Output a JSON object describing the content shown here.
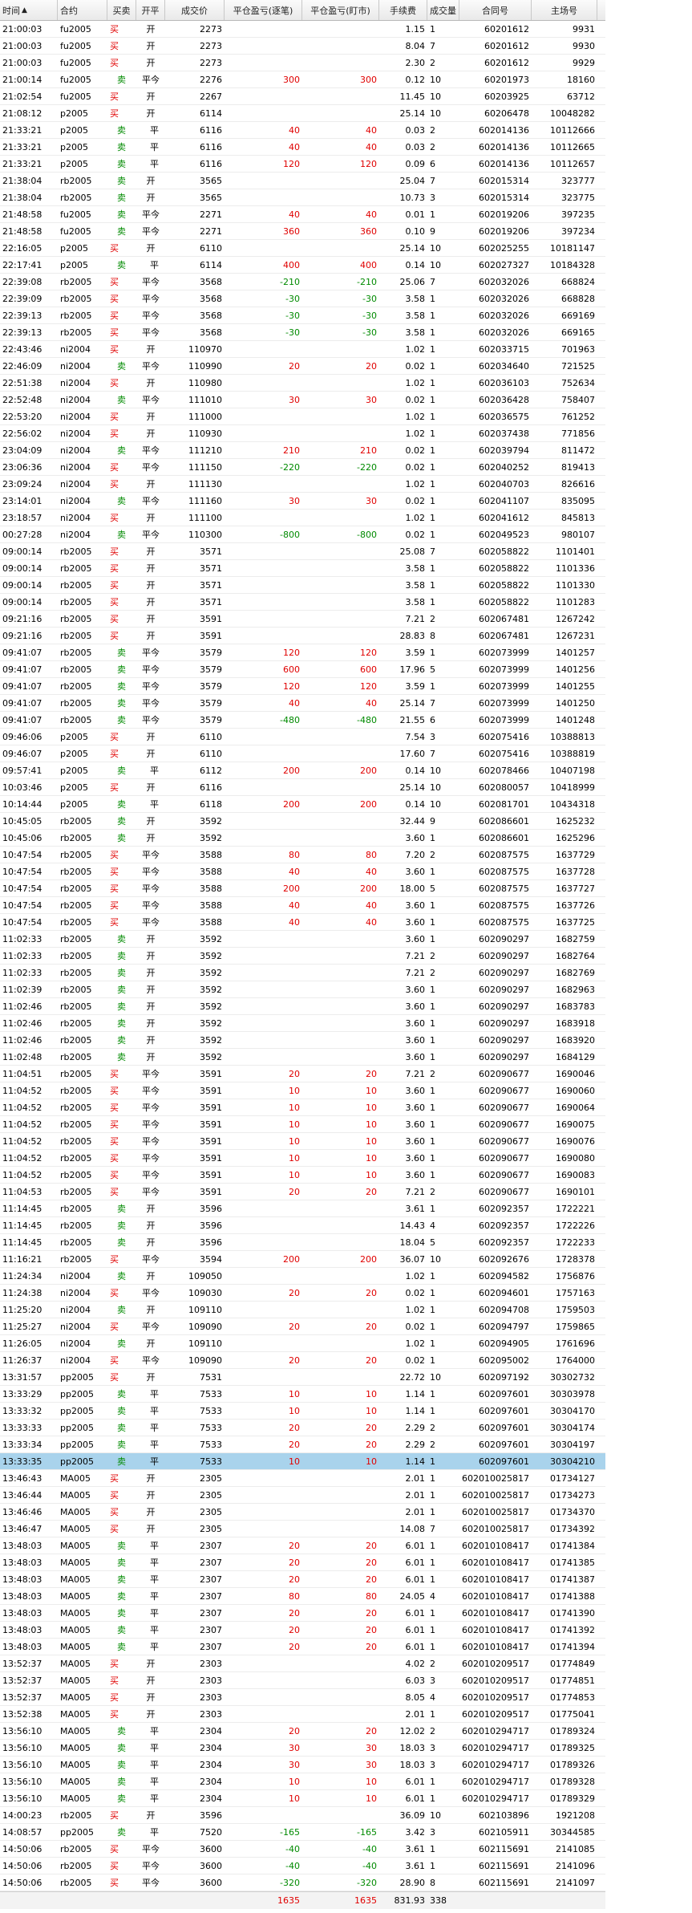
{
  "columns": {
    "time": "时间",
    "contract": "合约",
    "side": "买卖",
    "oc": "开平",
    "price": "成交价",
    "pnl_close": "平仓盈亏(逐笔)",
    "pnl_mark": "平仓盈亏(盯市)",
    "fee": "手续费",
    "qty": "成交量",
    "order": "合同号",
    "seq": "主场号",
    "sort_arrow": "▲"
  },
  "rows": [
    [
      "21:00:03",
      "fu2005",
      "买",
      "开",
      "2273",
      "",
      "",
      "1.15",
      "1",
      "60201612",
      "9931"
    ],
    [
      "21:00:03",
      "fu2005",
      "买",
      "开",
      "2273",
      "",
      "",
      "8.04",
      "7",
      "60201612",
      "9930"
    ],
    [
      "21:00:03",
      "fu2005",
      "买",
      "开",
      "2273",
      "",
      "",
      "2.30",
      "2",
      "60201612",
      "9929"
    ],
    [
      "21:00:14",
      "fu2005",
      "卖",
      "平今",
      "2276",
      "300",
      "300",
      "0.12",
      "10",
      "60201973",
      "18160"
    ],
    [
      "21:02:54",
      "fu2005",
      "买",
      "开",
      "2267",
      "",
      "",
      "11.45",
      "10",
      "60203925",
      "63712"
    ],
    [
      "21:08:12",
      "p2005",
      "买",
      "开",
      "6114",
      "",
      "",
      "25.14",
      "10",
      "60206478",
      "10048282"
    ],
    [
      "21:33:21",
      "p2005",
      "卖",
      "平",
      "6116",
      "40",
      "40",
      "0.03",
      "2",
      "602014136",
      "10112666"
    ],
    [
      "21:33:21",
      "p2005",
      "卖",
      "平",
      "6116",
      "40",
      "40",
      "0.03",
      "2",
      "602014136",
      "10112665"
    ],
    [
      "21:33:21",
      "p2005",
      "卖",
      "平",
      "6116",
      "120",
      "120",
      "0.09",
      "6",
      "602014136",
      "10112657"
    ],
    [
      "21:38:04",
      "rb2005",
      "卖",
      "开",
      "3565",
      "",
      "",
      "25.04",
      "7",
      "602015314",
      "323777"
    ],
    [
      "21:38:04",
      "rb2005",
      "卖",
      "开",
      "3565",
      "",
      "",
      "10.73",
      "3",
      "602015314",
      "323775"
    ],
    [
      "21:48:58",
      "fu2005",
      "卖",
      "平今",
      "2271",
      "40",
      "40",
      "0.01",
      "1",
      "602019206",
      "397235"
    ],
    [
      "21:48:58",
      "fu2005",
      "卖",
      "平今",
      "2271",
      "360",
      "360",
      "0.10",
      "9",
      "602019206",
      "397234"
    ],
    [
      "22:16:05",
      "p2005",
      "买",
      "开",
      "6110",
      "",
      "",
      "25.14",
      "10",
      "602025255",
      "10181147"
    ],
    [
      "22:17:41",
      "p2005",
      "卖",
      "平",
      "6114",
      "400",
      "400",
      "0.14",
      "10",
      "602027327",
      "10184328"
    ],
    [
      "22:39:08",
      "rb2005",
      "买",
      "平今",
      "3568",
      "-210",
      "-210",
      "25.06",
      "7",
      "602032026",
      "668824"
    ],
    [
      "22:39:09",
      "rb2005",
      "买",
      "平今",
      "3568",
      "-30",
      "-30",
      "3.58",
      "1",
      "602032026",
      "668828"
    ],
    [
      "22:39:13",
      "rb2005",
      "买",
      "平今",
      "3568",
      "-30",
      "-30",
      "3.58",
      "1",
      "602032026",
      "669169"
    ],
    [
      "22:39:13",
      "rb2005",
      "买",
      "平今",
      "3568",
      "-30",
      "-30",
      "3.58",
      "1",
      "602032026",
      "669165"
    ],
    [
      "22:43:46",
      "ni2004",
      "买",
      "开",
      "110970",
      "",
      "",
      "1.02",
      "1",
      "602033715",
      "701963"
    ],
    [
      "22:46:09",
      "ni2004",
      "卖",
      "平今",
      "110990",
      "20",
      "20",
      "0.02",
      "1",
      "602034640",
      "721525"
    ],
    [
      "22:51:38",
      "ni2004",
      "买",
      "开",
      "110980",
      "",
      "",
      "1.02",
      "1",
      "602036103",
      "752634"
    ],
    [
      "22:52:48",
      "ni2004",
      "卖",
      "平今",
      "111010",
      "30",
      "30",
      "0.02",
      "1",
      "602036428",
      "758407"
    ],
    [
      "22:53:20",
      "ni2004",
      "买",
      "开",
      "111000",
      "",
      "",
      "1.02",
      "1",
      "602036575",
      "761252"
    ],
    [
      "22:56:02",
      "ni2004",
      "买",
      "开",
      "110930",
      "",
      "",
      "1.02",
      "1",
      "602037438",
      "771856"
    ],
    [
      "23:04:09",
      "ni2004",
      "卖",
      "平今",
      "111210",
      "210",
      "210",
      "0.02",
      "1",
      "602039794",
      "811472"
    ],
    [
      "23:06:36",
      "ni2004",
      "买",
      "平今",
      "111150",
      "-220",
      "-220",
      "0.02",
      "1",
      "602040252",
      "819413"
    ],
    [
      "23:09:24",
      "ni2004",
      "买",
      "开",
      "111130",
      "",
      "",
      "1.02",
      "1",
      "602040703",
      "826616"
    ],
    [
      "23:14:01",
      "ni2004",
      "卖",
      "平今",
      "111160",
      "30",
      "30",
      "0.02",
      "1",
      "602041107",
      "835095"
    ],
    [
      "23:18:57",
      "ni2004",
      "买",
      "开",
      "111100",
      "",
      "",
      "1.02",
      "1",
      "602041612",
      "845813"
    ],
    [
      "00:27:28",
      "ni2004",
      "卖",
      "平今",
      "110300",
      "-800",
      "-800",
      "0.02",
      "1",
      "602049523",
      "980107"
    ],
    [
      "09:00:14",
      "rb2005",
      "买",
      "开",
      "3571",
      "",
      "",
      "25.08",
      "7",
      "602058822",
      "1101401"
    ],
    [
      "09:00:14",
      "rb2005",
      "买",
      "开",
      "3571",
      "",
      "",
      "3.58",
      "1",
      "602058822",
      "1101336"
    ],
    [
      "09:00:14",
      "rb2005",
      "买",
      "开",
      "3571",
      "",
      "",
      "3.58",
      "1",
      "602058822",
      "1101330"
    ],
    [
      "09:00:14",
      "rb2005",
      "买",
      "开",
      "3571",
      "",
      "",
      "3.58",
      "1",
      "602058822",
      "1101283"
    ],
    [
      "09:21:16",
      "rb2005",
      "买",
      "开",
      "3591",
      "",
      "",
      "7.21",
      "2",
      "602067481",
      "1267242"
    ],
    [
      "09:21:16",
      "rb2005",
      "买",
      "开",
      "3591",
      "",
      "",
      "28.83",
      "8",
      "602067481",
      "1267231"
    ],
    [
      "09:41:07",
      "rb2005",
      "卖",
      "平今",
      "3579",
      "120",
      "120",
      "3.59",
      "1",
      "602073999",
      "1401257"
    ],
    [
      "09:41:07",
      "rb2005",
      "卖",
      "平今",
      "3579",
      "600",
      "600",
      "17.96",
      "5",
      "602073999",
      "1401256"
    ],
    [
      "09:41:07",
      "rb2005",
      "卖",
      "平今",
      "3579",
      "120",
      "120",
      "3.59",
      "1",
      "602073999",
      "1401255"
    ],
    [
      "09:41:07",
      "rb2005",
      "卖",
      "平今",
      "3579",
      "40",
      "40",
      "25.14",
      "7",
      "602073999",
      "1401250"
    ],
    [
      "09:41:07",
      "rb2005",
      "卖",
      "平今",
      "3579",
      "-480",
      "-480",
      "21.55",
      "6",
      "602073999",
      "1401248"
    ],
    [
      "09:46:06",
      "p2005",
      "买",
      "开",
      "6110",
      "",
      "",
      "7.54",
      "3",
      "602075416",
      "10388813"
    ],
    [
      "09:46:07",
      "p2005",
      "买",
      "开",
      "6110",
      "",
      "",
      "17.60",
      "7",
      "602075416",
      "10388819"
    ],
    [
      "09:57:41",
      "p2005",
      "卖",
      "平",
      "6112",
      "200",
      "200",
      "0.14",
      "10",
      "602078466",
      "10407198"
    ],
    [
      "10:03:46",
      "p2005",
      "买",
      "开",
      "6116",
      "",
      "",
      "25.14",
      "10",
      "602080057",
      "10418999"
    ],
    [
      "10:14:44",
      "p2005",
      "卖",
      "平",
      "6118",
      "200",
      "200",
      "0.14",
      "10",
      "602081701",
      "10434318"
    ],
    [
      "10:45:05",
      "rb2005",
      "卖",
      "开",
      "3592",
      "",
      "",
      "32.44",
      "9",
      "602086601",
      "1625232"
    ],
    [
      "10:45:06",
      "rb2005",
      "卖",
      "开",
      "3592",
      "",
      "",
      "3.60",
      "1",
      "602086601",
      "1625296"
    ],
    [
      "10:47:54",
      "rb2005",
      "买",
      "平今",
      "3588",
      "80",
      "80",
      "7.20",
      "2",
      "602087575",
      "1637729"
    ],
    [
      "10:47:54",
      "rb2005",
      "买",
      "平今",
      "3588",
      "40",
      "40",
      "3.60",
      "1",
      "602087575",
      "1637728"
    ],
    [
      "10:47:54",
      "rb2005",
      "买",
      "平今",
      "3588",
      "200",
      "200",
      "18.00",
      "5",
      "602087575",
      "1637727"
    ],
    [
      "10:47:54",
      "rb2005",
      "买",
      "平今",
      "3588",
      "40",
      "40",
      "3.60",
      "1",
      "602087575",
      "1637726"
    ],
    [
      "10:47:54",
      "rb2005",
      "买",
      "平今",
      "3588",
      "40",
      "40",
      "3.60",
      "1",
      "602087575",
      "1637725"
    ],
    [
      "11:02:33",
      "rb2005",
      "卖",
      "开",
      "3592",
      "",
      "",
      "3.60",
      "1",
      "602090297",
      "1682759"
    ],
    [
      "11:02:33",
      "rb2005",
      "卖",
      "开",
      "3592",
      "",
      "",
      "7.21",
      "2",
      "602090297",
      "1682764"
    ],
    [
      "11:02:33",
      "rb2005",
      "卖",
      "开",
      "3592",
      "",
      "",
      "7.21",
      "2",
      "602090297",
      "1682769"
    ],
    [
      "11:02:39",
      "rb2005",
      "卖",
      "开",
      "3592",
      "",
      "",
      "3.60",
      "1",
      "602090297",
      "1682963"
    ],
    [
      "11:02:46",
      "rb2005",
      "卖",
      "开",
      "3592",
      "",
      "",
      "3.60",
      "1",
      "602090297",
      "1683783"
    ],
    [
      "11:02:46",
      "rb2005",
      "卖",
      "开",
      "3592",
      "",
      "",
      "3.60",
      "1",
      "602090297",
      "1683918"
    ],
    [
      "11:02:46",
      "rb2005",
      "卖",
      "开",
      "3592",
      "",
      "",
      "3.60",
      "1",
      "602090297",
      "1683920"
    ],
    [
      "11:02:48",
      "rb2005",
      "卖",
      "开",
      "3592",
      "",
      "",
      "3.60",
      "1",
      "602090297",
      "1684129"
    ],
    [
      "11:04:51",
      "rb2005",
      "买",
      "平今",
      "3591",
      "20",
      "20",
      "7.21",
      "2",
      "602090677",
      "1690046"
    ],
    [
      "11:04:52",
      "rb2005",
      "买",
      "平今",
      "3591",
      "10",
      "10",
      "3.60",
      "1",
      "602090677",
      "1690060"
    ],
    [
      "11:04:52",
      "rb2005",
      "买",
      "平今",
      "3591",
      "10",
      "10",
      "3.60",
      "1",
      "602090677",
      "1690064"
    ],
    [
      "11:04:52",
      "rb2005",
      "买",
      "平今",
      "3591",
      "10",
      "10",
      "3.60",
      "1",
      "602090677",
      "1690075"
    ],
    [
      "11:04:52",
      "rb2005",
      "买",
      "平今",
      "3591",
      "10",
      "10",
      "3.60",
      "1",
      "602090677",
      "1690076"
    ],
    [
      "11:04:52",
      "rb2005",
      "买",
      "平今",
      "3591",
      "10",
      "10",
      "3.60",
      "1",
      "602090677",
      "1690080"
    ],
    [
      "11:04:52",
      "rb2005",
      "买",
      "平今",
      "3591",
      "10",
      "10",
      "3.60",
      "1",
      "602090677",
      "1690083"
    ],
    [
      "11:04:53",
      "rb2005",
      "买",
      "平今",
      "3591",
      "20",
      "20",
      "7.21",
      "2",
      "602090677",
      "1690101"
    ],
    [
      "11:14:45",
      "rb2005",
      "卖",
      "开",
      "3596",
      "",
      "",
      "3.61",
      "1",
      "602092357",
      "1722221"
    ],
    [
      "11:14:45",
      "rb2005",
      "卖",
      "开",
      "3596",
      "",
      "",
      "14.43",
      "4",
      "602092357",
      "1722226"
    ],
    [
      "11:14:45",
      "rb2005",
      "卖",
      "开",
      "3596",
      "",
      "",
      "18.04",
      "5",
      "602092357",
      "1722233"
    ],
    [
      "11:16:21",
      "rb2005",
      "买",
      "平今",
      "3594",
      "200",
      "200",
      "36.07",
      "10",
      "602092676",
      "1728378"
    ],
    [
      "11:24:34",
      "ni2004",
      "卖",
      "开",
      "109050",
      "",
      "",
      "1.02",
      "1",
      "602094582",
      "1756876"
    ],
    [
      "11:24:38",
      "ni2004",
      "买",
      "平今",
      "109030",
      "20",
      "20",
      "0.02",
      "1",
      "602094601",
      "1757163"
    ],
    [
      "11:25:20",
      "ni2004",
      "卖",
      "开",
      "109110",
      "",
      "",
      "1.02",
      "1",
      "602094708",
      "1759503"
    ],
    [
      "11:25:27",
      "ni2004",
      "买",
      "平今",
      "109090",
      "20",
      "20",
      "0.02",
      "1",
      "602094797",
      "1759865"
    ],
    [
      "11:26:05",
      "ni2004",
      "卖",
      "开",
      "109110",
      "",
      "",
      "1.02",
      "1",
      "602094905",
      "1761696"
    ],
    [
      "11:26:37",
      "ni2004",
      "买",
      "平今",
      "109090",
      "20",
      "20",
      "0.02",
      "1",
      "602095002",
      "1764000"
    ],
    [
      "13:31:57",
      "pp2005",
      "买",
      "开",
      "7531",
      "",
      "",
      "22.72",
      "10",
      "602097192",
      "30302732"
    ],
    [
      "13:33:29",
      "pp2005",
      "卖",
      "平",
      "7533",
      "10",
      "10",
      "1.14",
      "1",
      "602097601",
      "30303978"
    ],
    [
      "13:33:32",
      "pp2005",
      "卖",
      "平",
      "7533",
      "10",
      "10",
      "1.14",
      "1",
      "602097601",
      "30304170"
    ],
    [
      "13:33:33",
      "pp2005",
      "卖",
      "平",
      "7533",
      "20",
      "20",
      "2.29",
      "2",
      "602097601",
      "30304174"
    ],
    [
      "13:33:34",
      "pp2005",
      "卖",
      "平",
      "7533",
      "20",
      "20",
      "2.29",
      "2",
      "602097601",
      "30304197"
    ],
    [
      "13:33:35",
      "pp2005",
      "卖",
      "平",
      "7533",
      "10",
      "10",
      "1.14",
      "1",
      "602097601",
      "30304210"
    ],
    [
      "13:46:43",
      "MA005",
      "买",
      "开",
      "2305",
      "",
      "",
      "2.01",
      "1",
      "602010025817",
      "01734127"
    ],
    [
      "13:46:44",
      "MA005",
      "买",
      "开",
      "2305",
      "",
      "",
      "2.01",
      "1",
      "602010025817",
      "01734273"
    ],
    [
      "13:46:46",
      "MA005",
      "买",
      "开",
      "2305",
      "",
      "",
      "2.01",
      "1",
      "602010025817",
      "01734370"
    ],
    [
      "13:46:47",
      "MA005",
      "买",
      "开",
      "2305",
      "",
      "",
      "14.08",
      "7",
      "602010025817",
      "01734392"
    ],
    [
      "13:48:03",
      "MA005",
      "卖",
      "平",
      "2307",
      "20",
      "20",
      "6.01",
      "1",
      "602010108417",
      "01741384"
    ],
    [
      "13:48:03",
      "MA005",
      "卖",
      "平",
      "2307",
      "20",
      "20",
      "6.01",
      "1",
      "602010108417",
      "01741385"
    ],
    [
      "13:48:03",
      "MA005",
      "卖",
      "平",
      "2307",
      "20",
      "20",
      "6.01",
      "1",
      "602010108417",
      "01741387"
    ],
    [
      "13:48:03",
      "MA005",
      "卖",
      "平",
      "2307",
      "80",
      "80",
      "24.05",
      "4",
      "602010108417",
      "01741388"
    ],
    [
      "13:48:03",
      "MA005",
      "卖",
      "平",
      "2307",
      "20",
      "20",
      "6.01",
      "1",
      "602010108417",
      "01741390"
    ],
    [
      "13:48:03",
      "MA005",
      "卖",
      "平",
      "2307",
      "20",
      "20",
      "6.01",
      "1",
      "602010108417",
      "01741392"
    ],
    [
      "13:48:03",
      "MA005",
      "卖",
      "平",
      "2307",
      "20",
      "20",
      "6.01",
      "1",
      "602010108417",
      "01741394"
    ],
    [
      "13:52:37",
      "MA005",
      "买",
      "开",
      "2303",
      "",
      "",
      "4.02",
      "2",
      "602010209517",
      "01774849"
    ],
    [
      "13:52:37",
      "MA005",
      "买",
      "开",
      "2303",
      "",
      "",
      "6.03",
      "3",
      "602010209517",
      "01774851"
    ],
    [
      "13:52:37",
      "MA005",
      "买",
      "开",
      "2303",
      "",
      "",
      "8.05",
      "4",
      "602010209517",
      "01774853"
    ],
    [
      "13:52:38",
      "MA005",
      "买",
      "开",
      "2303",
      "",
      "",
      "2.01",
      "1",
      "602010209517",
      "01775041"
    ],
    [
      "13:56:10",
      "MA005",
      "卖",
      "平",
      "2304",
      "20",
      "20",
      "12.02",
      "2",
      "602010294717",
      "01789324"
    ],
    [
      "13:56:10",
      "MA005",
      "卖",
      "平",
      "2304",
      "30",
      "30",
      "18.03",
      "3",
      "602010294717",
      "01789325"
    ],
    [
      "13:56:10",
      "MA005",
      "卖",
      "平",
      "2304",
      "30",
      "30",
      "18.03",
      "3",
      "602010294717",
      "01789326"
    ],
    [
      "13:56:10",
      "MA005",
      "卖",
      "平",
      "2304",
      "10",
      "10",
      "6.01",
      "1",
      "602010294717",
      "01789328"
    ],
    [
      "13:56:10",
      "MA005",
      "卖",
      "平",
      "2304",
      "10",
      "10",
      "6.01",
      "1",
      "602010294717",
      "01789329"
    ],
    [
      "14:00:23",
      "rb2005",
      "买",
      "开",
      "3596",
      "",
      "",
      "36.09",
      "10",
      "602103896",
      "1921208"
    ],
    [
      "14:08:57",
      "pp2005",
      "卖",
      "平",
      "7520",
      "-165",
      "-165",
      "3.42",
      "3",
      "602105911",
      "30344585"
    ],
    [
      "14:50:06",
      "rb2005",
      "买",
      "平今",
      "3600",
      "-40",
      "-40",
      "3.61",
      "1",
      "602115691",
      "2141085"
    ],
    [
      "14:50:06",
      "rb2005",
      "买",
      "平今",
      "3600",
      "-40",
      "-40",
      "3.61",
      "1",
      "602115691",
      "2141096"
    ],
    [
      "14:50:06",
      "rb2005",
      "买",
      "平今",
      "3600",
      "-320",
      "-320",
      "28.90",
      "8",
      "602115691",
      "2141097"
    ]
  ],
  "selected_row_index": 85,
  "totals": {
    "pnl_close": "1635",
    "pnl_mark": "1635",
    "fee": "831.93",
    "qty": "338"
  },
  "colors": {
    "buy": "#e00000",
    "sell": "#008a00",
    "selected": "#a9d3ec"
  }
}
